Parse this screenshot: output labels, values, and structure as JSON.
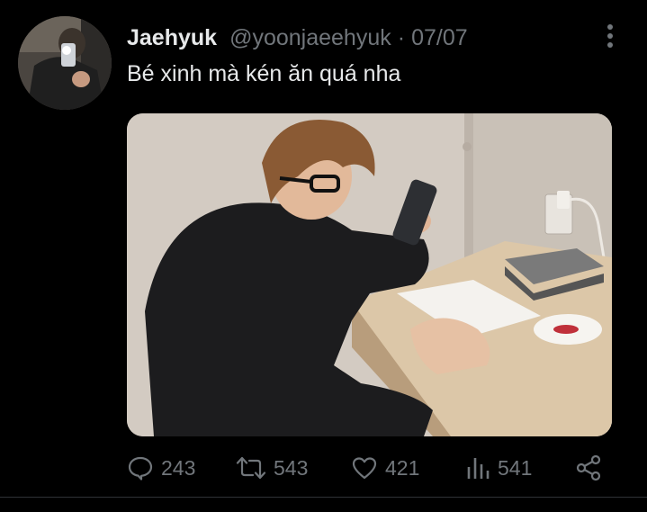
{
  "tweet": {
    "display_name": "Jaehyuk",
    "handle": "@yoonjaeehyuk",
    "separator": "·",
    "date": "07/07",
    "text": "Bé xinh mà kén ăn quá nha"
  },
  "actions": {
    "replies": "243",
    "retweets": "543",
    "likes": "421",
    "views": "541"
  },
  "icons": {
    "more": "more-vertical-icon",
    "reply": "reply-icon",
    "retweet": "retweet-icon",
    "like": "heart-icon",
    "views": "views-icon",
    "share": "share-icon"
  },
  "colors": {
    "background": "#000000",
    "text_primary": "#e7e9ea",
    "text_secondary": "#71767b",
    "divider": "#2f3336"
  }
}
